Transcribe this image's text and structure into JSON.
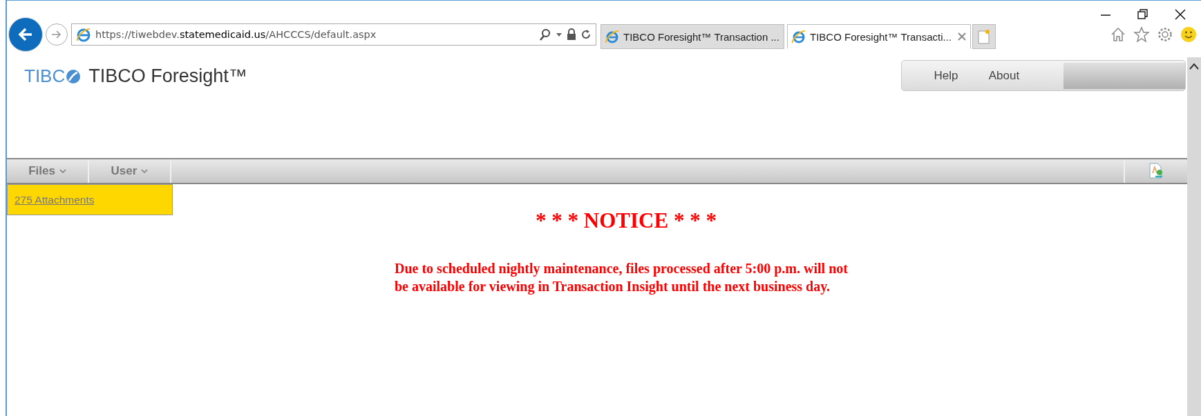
{
  "browser": {
    "address": "https://tiwebdev.**statemedicaid.us**/AHCCCS/default.aspx",
    "tabs": [
      {
        "label": "TIBCO Foresight™ Transaction ...",
        "selected": false
      },
      {
        "label": "TIBCO Foresight™ Transacti...",
        "selected": true
      }
    ]
  },
  "app": {
    "logo": "TIBC",
    "title": "TIBCO Foresight™",
    "header_links": [
      "Help",
      "About"
    ],
    "menu": [
      {
        "label": "Files"
      },
      {
        "label": "User"
      }
    ],
    "attachments_link": "275 Attachments",
    "notice": {
      "heading": "* * * NOTICE * * *",
      "message": "Due to scheduled nightly maintenance, files processed after 5:00 p.m. will not be available for viewing in Transaction Insight until the next business day."
    }
  }
}
